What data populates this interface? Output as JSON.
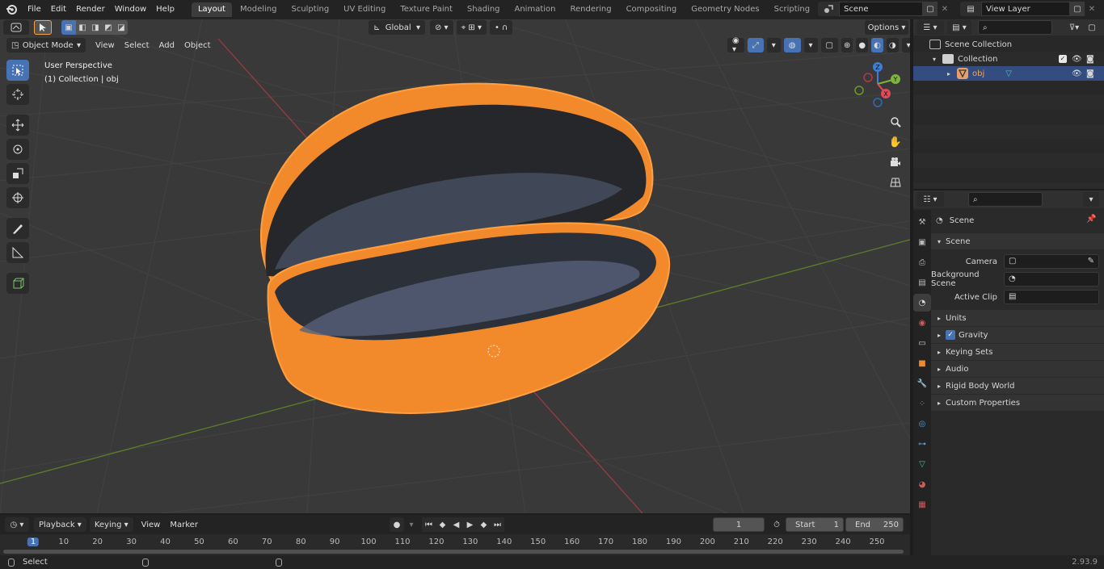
{
  "menu": [
    "File",
    "Edit",
    "Render",
    "Window",
    "Help"
  ],
  "workspaces": [
    "Layout",
    "Modeling",
    "Sculpting",
    "UV Editing",
    "Texture Paint",
    "Shading",
    "Animation",
    "Rendering",
    "Compositing",
    "Geometry Nodes",
    "Scripting"
  ],
  "scene_name": "Scene",
  "view_layer": "View Layer",
  "viewport": {
    "mode": "Object Mode",
    "menus": [
      "View",
      "Select",
      "Add",
      "Object"
    ],
    "orientation": "Global",
    "options_label": "Options",
    "overlay_title": "User Perspective",
    "overlay_sub": "(1) Collection | obj",
    "gizmo": {
      "x": "X",
      "y": "Y",
      "z": "Z"
    }
  },
  "outliner": {
    "scene_collection": "Scene Collection",
    "collection": "Collection",
    "object": "obj"
  },
  "properties": {
    "header": "Scene",
    "panel": "Scene",
    "camera_label": "Camera",
    "bg_scene_label": "Background Scene",
    "active_clip_label": "Active Clip",
    "sections": [
      "Units",
      "Gravity",
      "Keying Sets",
      "Audio",
      "Rigid Body World",
      "Custom Properties"
    ],
    "gravity_checked": true
  },
  "timeline": {
    "menus": [
      "Playback",
      "Keying",
      "View",
      "Marker"
    ],
    "current_frame": "1",
    "start_label": "Start",
    "start_value": "1",
    "end_label": "End",
    "end_value": "250",
    "ruler": [
      "1",
      "10",
      "20",
      "30",
      "40",
      "50",
      "60",
      "70",
      "80",
      "90",
      "100",
      "110",
      "120",
      "130",
      "140",
      "150",
      "160",
      "170",
      "180",
      "190",
      "200",
      "210",
      "220",
      "230",
      "240",
      "250"
    ]
  },
  "status": {
    "left": "Select",
    "version": "2.93.9"
  },
  "colors": {
    "accent": "#4772b3",
    "selected_orange": "#f28a2c",
    "x_axis": "#c74451",
    "y_axis": "#6c9a27"
  }
}
